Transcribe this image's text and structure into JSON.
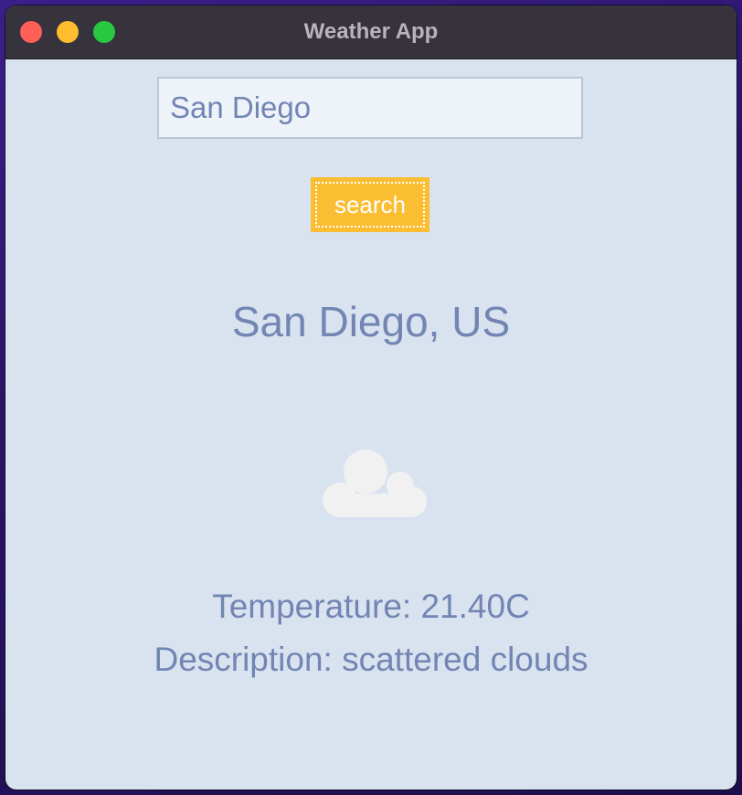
{
  "window": {
    "title": "Weather App"
  },
  "search": {
    "value": "San Diego",
    "button_label": "search"
  },
  "result": {
    "location": "San Diego, US",
    "icon": "cloud-icon",
    "temperature": "Temperature: 21.40C",
    "description": "Description: scattered clouds"
  },
  "colors": {
    "window_background": "#d9e3f0",
    "titlebar": "#36333d",
    "text": "#7285b3",
    "button": "#fbbd32",
    "close": "#fe5f57",
    "minimize": "#febc2e",
    "maximize": "#28c840"
  }
}
